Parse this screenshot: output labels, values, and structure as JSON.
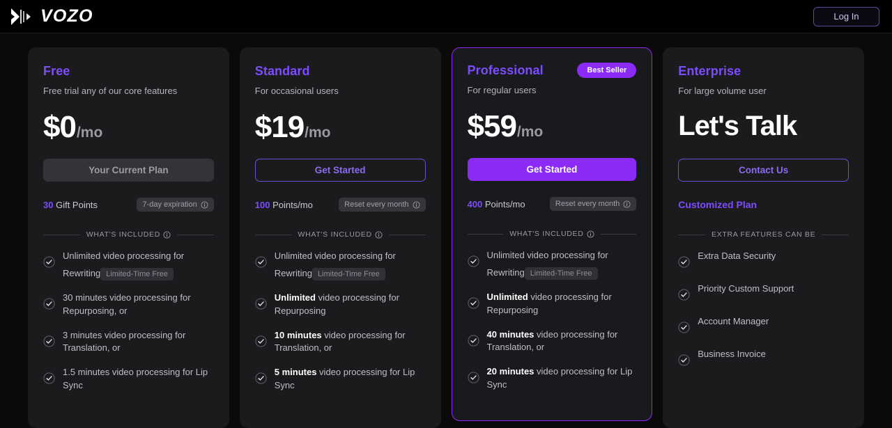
{
  "header": {
    "brand_name": "VOZO",
    "login_label": "Log In"
  },
  "plans": [
    {
      "name": "Free",
      "subtitle": "Free trial any of our core features",
      "price_main": "$0",
      "price_per": "/mo",
      "cta_label": "Your Current Plan",
      "cta_style": "current",
      "points_number": "30",
      "points_unit": " Gift Points",
      "pill_label": "7-day expiration",
      "divider_label": "WHAT'S INCLUDED",
      "features": [
        {
          "bold": "",
          "text": "Unlimited video processing for Rewriting",
          "tag": "Limited-Time Free"
        },
        {
          "bold": "",
          "text": "30 minutes video processing for Repurposing, or",
          "tag": ""
        },
        {
          "bold": "",
          "text": "3 minutes video processing for Translation, or",
          "tag": ""
        },
        {
          "bold": "",
          "text": "1.5 minutes video processing for Lip Sync",
          "tag": ""
        }
      ]
    },
    {
      "name": "Standard",
      "subtitle": "For occasional users",
      "price_main": "$19",
      "price_per": "/mo",
      "cta_label": "Get Started",
      "cta_style": "outline",
      "points_number": "100",
      "points_unit": " Points/mo",
      "pill_label": "Reset every month",
      "divider_label": "WHAT'S INCLUDED",
      "features": [
        {
          "bold": "",
          "text": "Unlimited video processing for Rewriting",
          "tag": "Limited-Time Free"
        },
        {
          "bold": "Unlimited",
          "text": " video processing for Repurposing",
          "tag": ""
        },
        {
          "bold": "10 minutes",
          "text": " video processing for Translation, or",
          "tag": ""
        },
        {
          "bold": "5 minutes",
          "text": " video processing for Lip Sync",
          "tag": ""
        }
      ]
    },
    {
      "name": "Professional",
      "subtitle": "For regular users",
      "badge": "Best Seller",
      "price_main": "$59",
      "price_per": "/mo",
      "cta_label": "Get Started",
      "cta_style": "solid",
      "points_number": "400",
      "points_unit": " Points/mo",
      "pill_label": "Reset every month",
      "divider_label": "WHAT'S INCLUDED",
      "features": [
        {
          "bold": "",
          "text": "Unlimited video processing for Rewriting",
          "tag": "Limited-Time Free"
        },
        {
          "bold": "Unlimited",
          "text": " video processing for Repurposing",
          "tag": ""
        },
        {
          "bold": "40 minutes",
          "text": " video processing for Translation, or",
          "tag": ""
        },
        {
          "bold": "20 minutes",
          "text": " video processing for Lip Sync",
          "tag": ""
        }
      ]
    },
    {
      "name": "Enterprise",
      "subtitle": "For large volume user",
      "price_main": "Let's Talk",
      "price_per": "",
      "cta_label": "Contact Us",
      "cta_style": "outline",
      "custom_plan_label": "Customized Plan",
      "divider_label": "EXTRA FEATURES CAN BE",
      "features": [
        {
          "bold": "",
          "text": "Extra Data Security",
          "tag": ""
        },
        {
          "bold": "",
          "text": "Priority Custom Support",
          "tag": ""
        },
        {
          "bold": "",
          "text": "Account Manager",
          "tag": ""
        },
        {
          "bold": "",
          "text": "Business Invoice",
          "tag": ""
        }
      ]
    }
  ],
  "colors": {
    "accent": "#8b2bf5",
    "accent_text": "#7c4dff",
    "page_bg": "#0a0a0b",
    "card_bg": "#1b1b1e"
  }
}
